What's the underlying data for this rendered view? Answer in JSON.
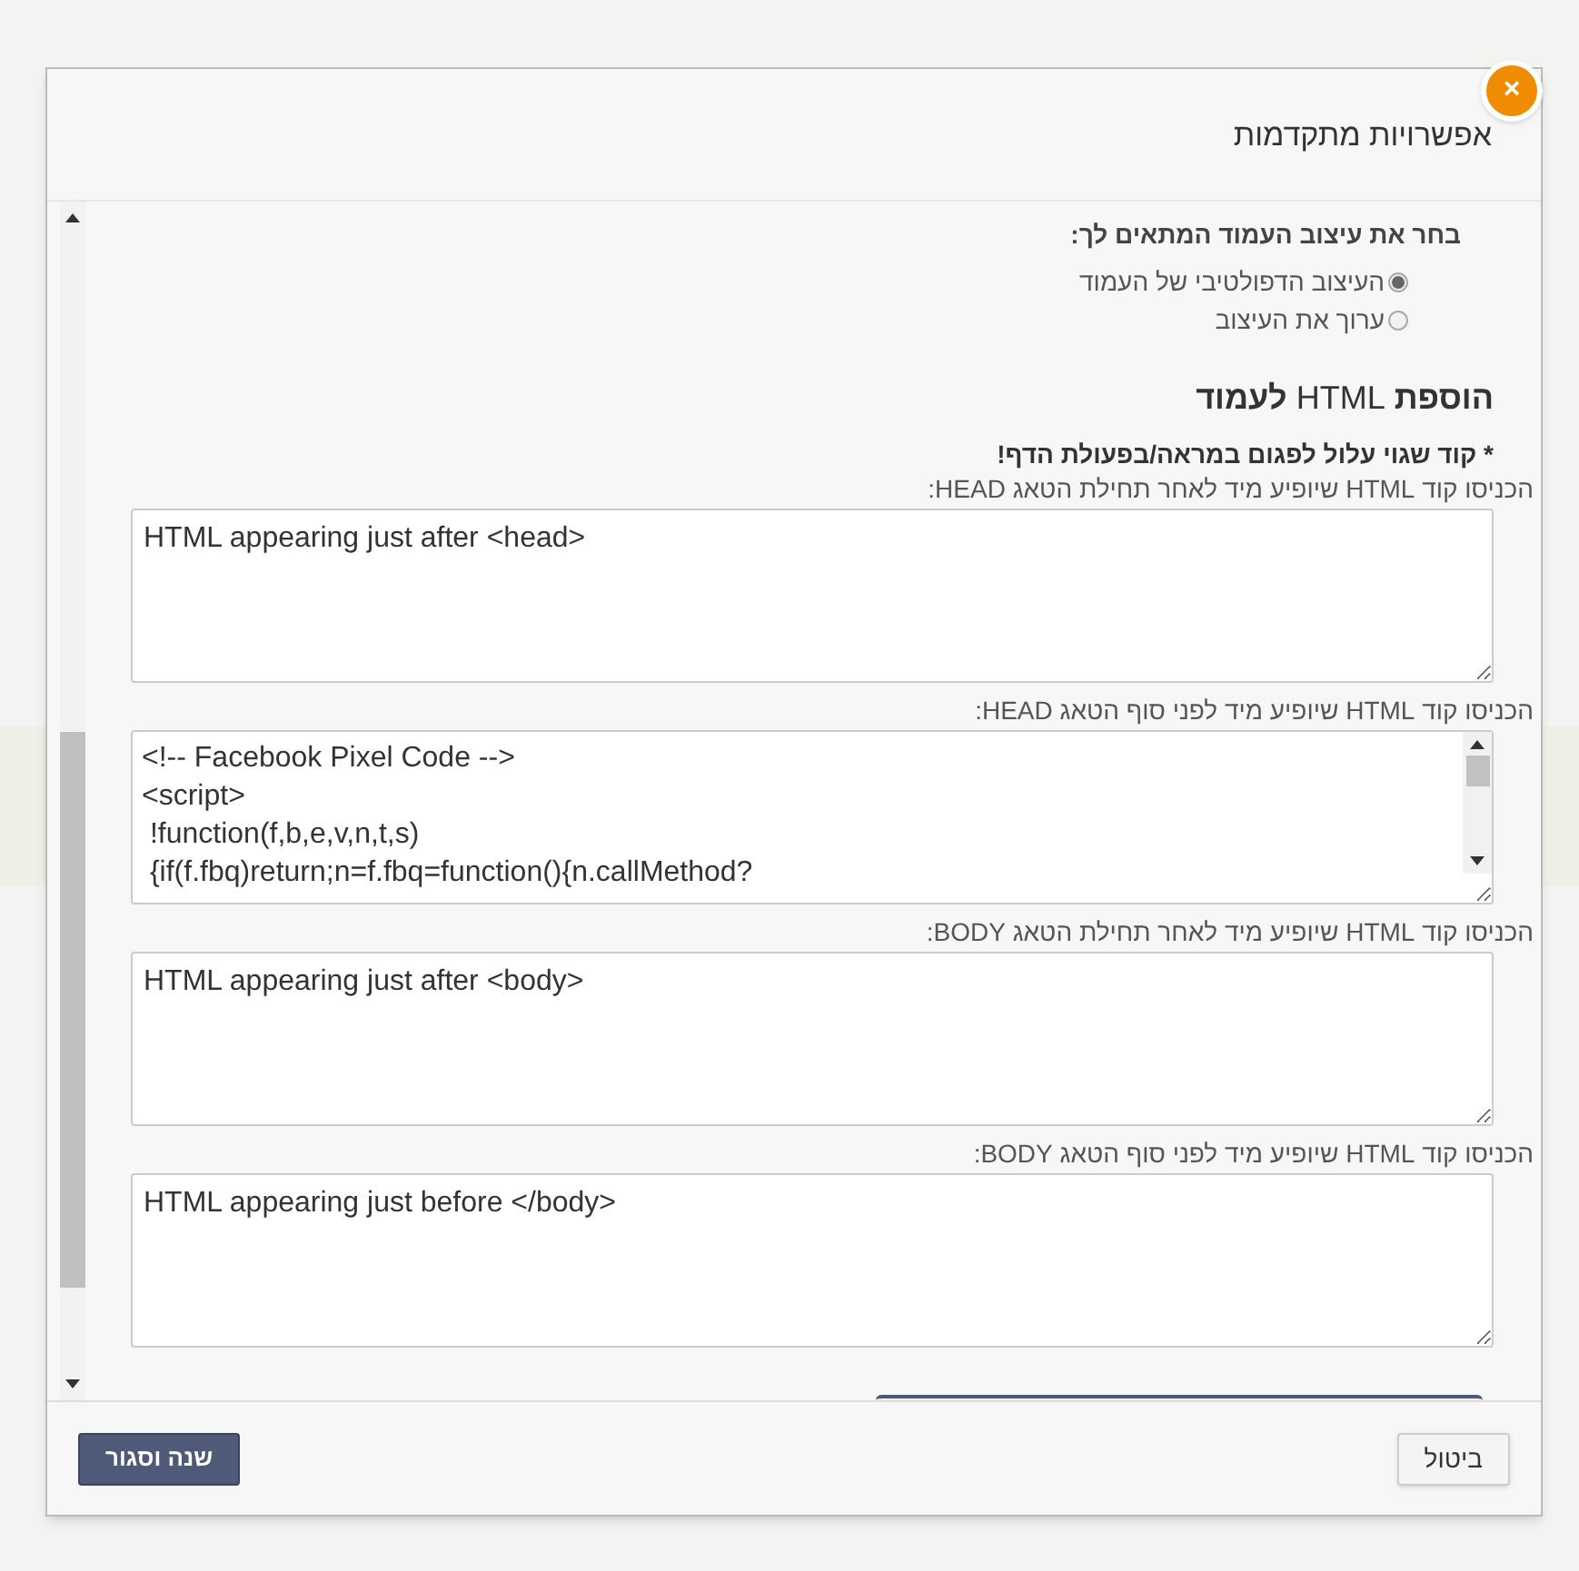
{
  "dialog": {
    "title": "אפשרויות מתקדמות",
    "close_label": "×"
  },
  "design": {
    "heading": "בחר את עיצוב העמוד המתאים לך:",
    "options": [
      {
        "label": "העיצוב הדפולטיבי של העמוד",
        "selected": true
      },
      {
        "label": "ערוך את העיצוב",
        "selected": false
      }
    ]
  },
  "html": {
    "heading": "**הוספת** HTML **לעמוד**",
    "warning": "* קוד שגוי עלול לפגום במראה/בפעולת הדף!",
    "fields": [
      {
        "label": "הכניסו קוד HTML שיופיע מיד לאחר תחילת הטאג HEAD:",
        "value": "HTML appearing just after <head>"
      },
      {
        "label": "הכניסו קוד HTML שיופיע מיד לפני סוף הטאג HEAD:",
        "value": "<!-- Facebook Pixel Code -->\n<script>\n !function(f,b,e,v,n,t,s)\n {if(f.fbq)return;n=f.fbq=function(){n.callMethod?",
        "kind": "code"
      },
      {
        "label": "הכניסו קוד HTML שיופיע מיד לאחר תחילת הטאג BODY:",
        "value": "HTML appearing just after <body>"
      },
      {
        "label": "הכניסו קוד HTML שיופיע מיד לפני סוף הטאג BODY:",
        "value": "HTML appearing just before </body>"
      }
    ]
  },
  "buttons": [
    {
      "label": "ביטול",
      "kind": "secondary"
    },
    {
      "label": "שנה וסגור",
      "kind": "primary"
    }
  ]
}
